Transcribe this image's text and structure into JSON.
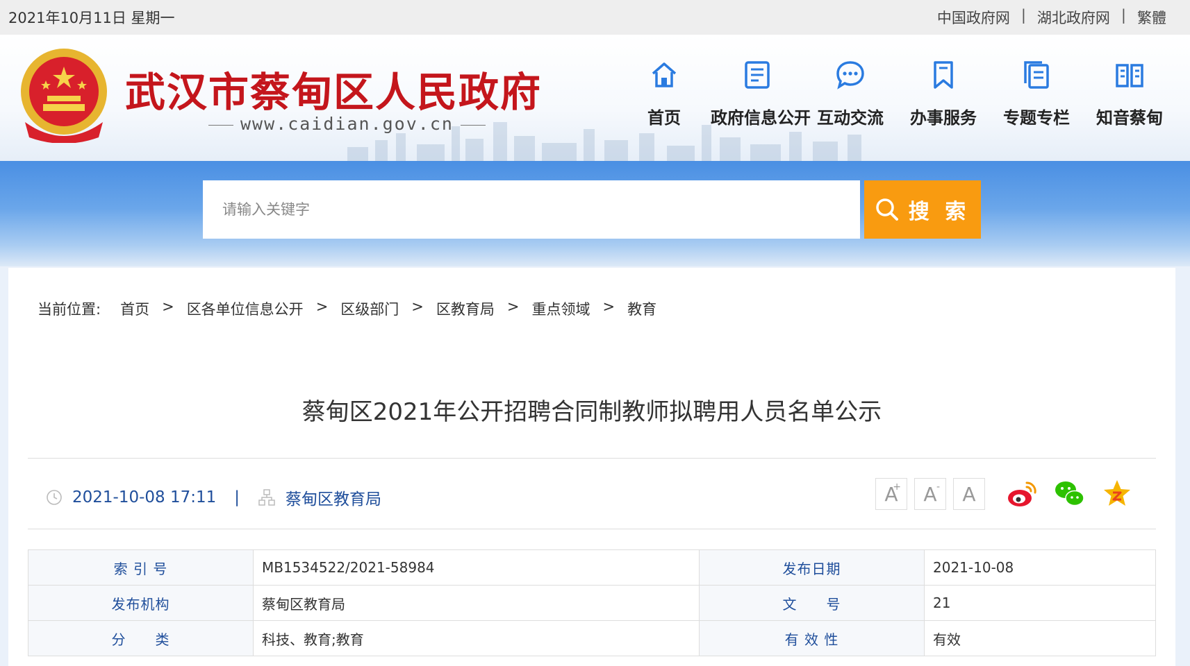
{
  "topbar": {
    "date": "2021年10月11日 星期一",
    "links": [
      "中国政府网",
      "湖北政府网",
      "繁體"
    ],
    "separator": "|"
  },
  "header": {
    "title": "武汉市蔡甸区人民政府",
    "url": "www.caidian.gov.cn",
    "emblem": "national-emblem",
    "nav": [
      {
        "label": "首页",
        "icon": "home-icon"
      },
      {
        "label": "政府信息公开",
        "icon": "document-icon"
      },
      {
        "label": "互动交流",
        "icon": "chat-icon"
      },
      {
        "label": "办事服务",
        "icon": "bookmark-icon"
      },
      {
        "label": "专题专栏",
        "icon": "pages-icon"
      },
      {
        "label": "知音蔡甸",
        "icon": "book-icon"
      }
    ]
  },
  "search": {
    "placeholder": "请输入关键字",
    "button_label": "搜 索",
    "button_color": "#f99b10"
  },
  "breadcrumb": {
    "label": "当前位置:",
    "items": [
      "首页",
      "区各单位信息公开",
      "区级部门",
      "区教育局",
      "重点领域",
      "教育"
    ],
    "separator": ">"
  },
  "article": {
    "title": "蔡甸区2021年公开招聘合同制教师拟聘用人员名单公示",
    "datetime": "2021-10-08 17:11",
    "org": "蔡甸区教育局",
    "font_controls": [
      "A",
      "A",
      "A"
    ],
    "font_control_marks": [
      "+",
      "-",
      ""
    ],
    "share": [
      "weibo-icon",
      "wechat-icon",
      "favorite-icon"
    ]
  },
  "info_table": {
    "rows": [
      {
        "k1": "索 引 号",
        "v1": "MB1534522/2021-58984",
        "k2": "发布日期",
        "v2": "2021-10-08"
      },
      {
        "k1": "发布机构",
        "v1": "蔡甸区教育局",
        "k2": "文　　号",
        "v2": "21"
      },
      {
        "k1": "分　　类",
        "v1": "科技、教育;教育",
        "k2": "有 效 性",
        "v2": "有效"
      }
    ]
  },
  "colors": {
    "title_red": "#c4161c",
    "link_blue": "#1f4e9b",
    "band_blue": "#4a8fe3"
  }
}
